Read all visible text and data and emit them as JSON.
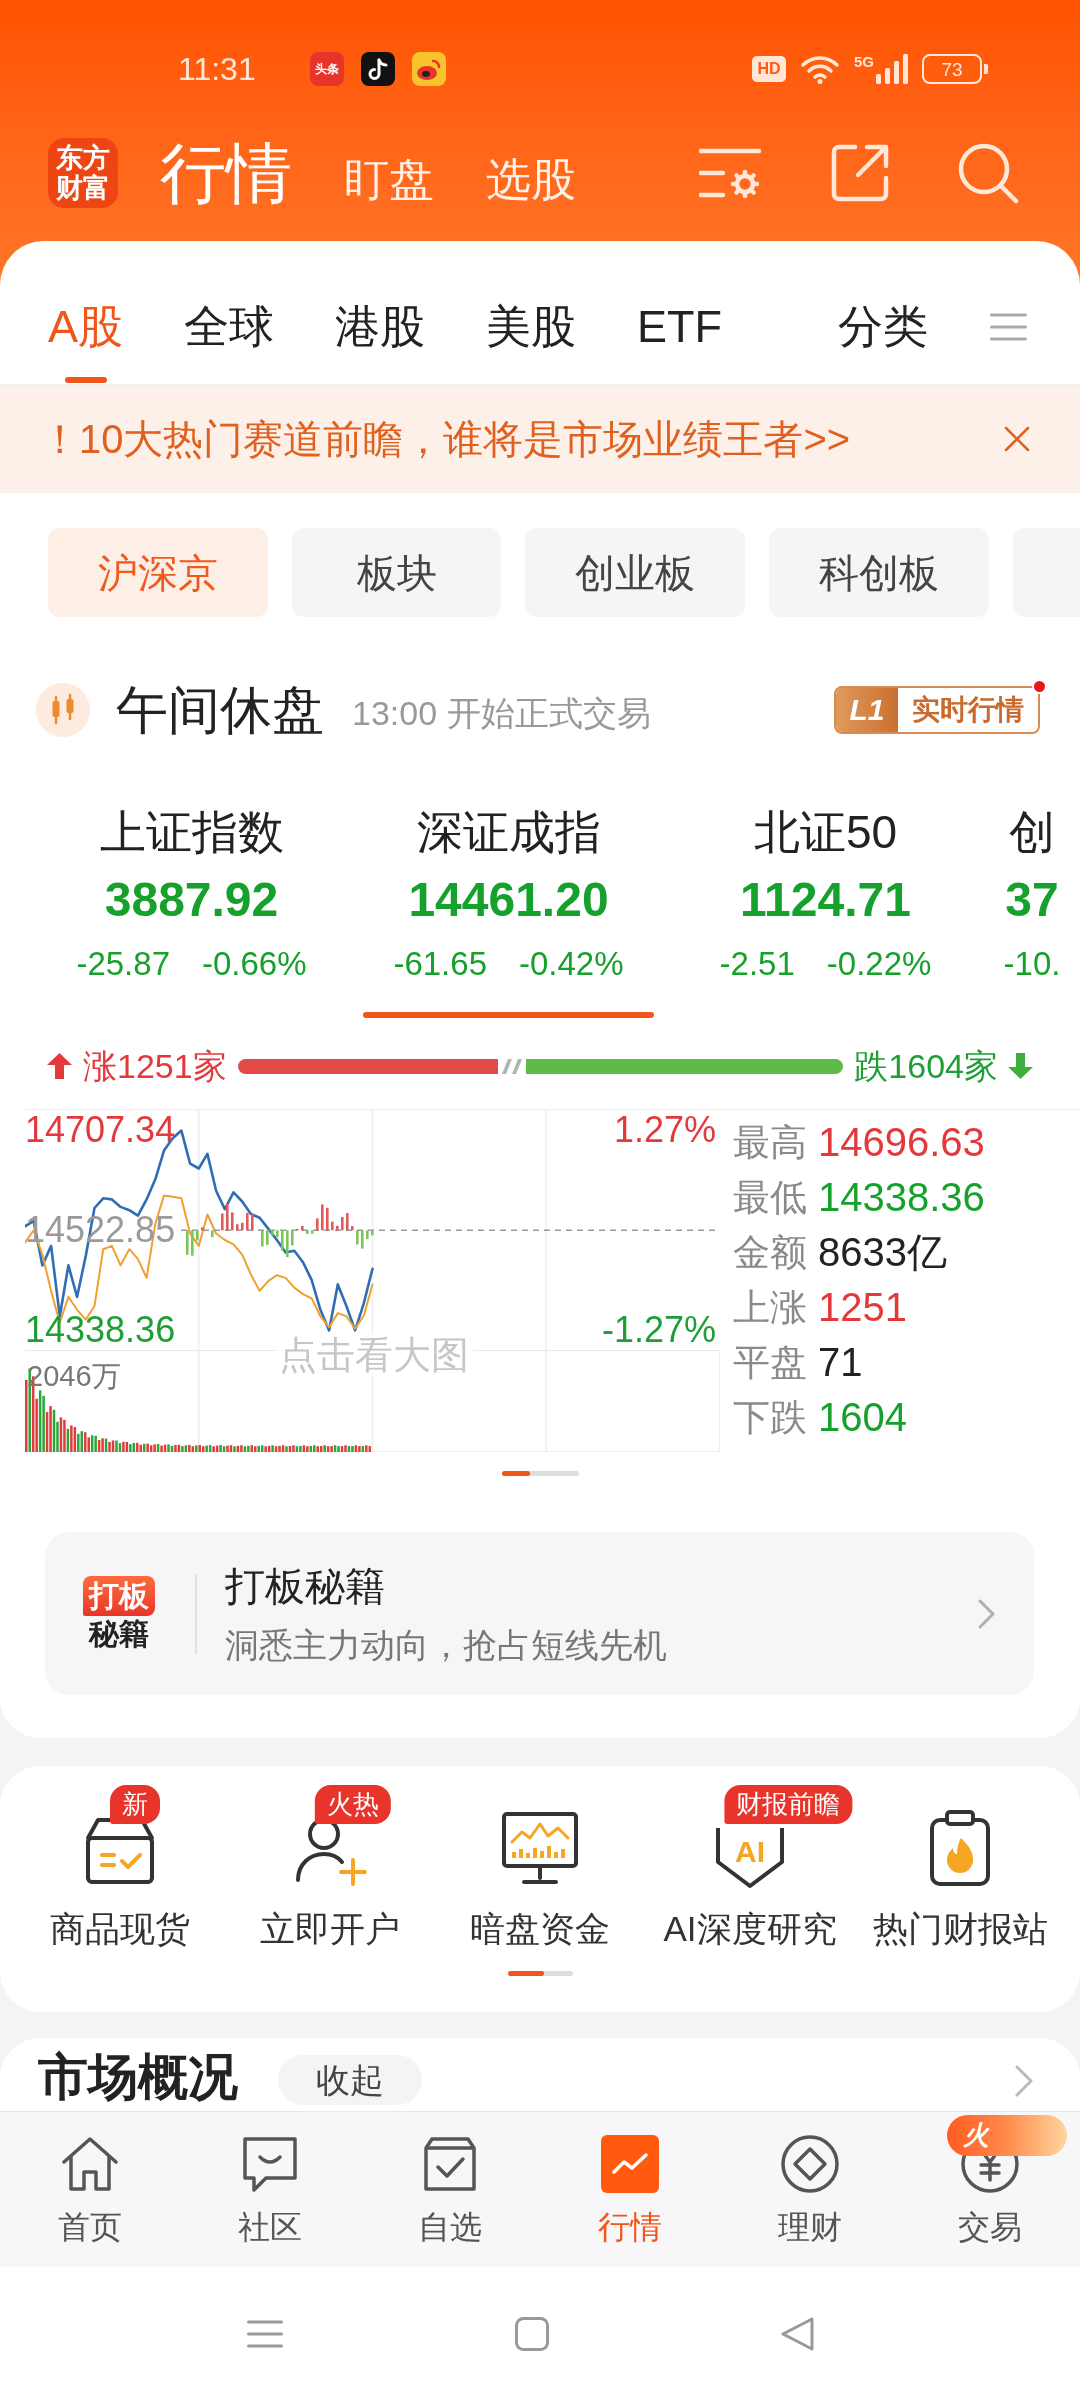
{
  "status_bar": {
    "time": "11:31",
    "notifications": [
      {
        "kind": "text",
        "text": "头条"
      },
      {
        "kind": "note"
      },
      {
        "kind": "eye"
      }
    ],
    "hd": "HD",
    "network": "5G",
    "battery": "73"
  },
  "header": {
    "logo": "东方财富",
    "tabs": [
      {
        "label": "行情",
        "selected": true
      },
      {
        "label": "盯盘",
        "selected": false
      },
      {
        "label": "选股",
        "selected": false
      }
    ]
  },
  "market_tabs": [
    {
      "label": "A股",
      "selected": true
    },
    {
      "label": "全球",
      "selected": false
    },
    {
      "label": "港股",
      "selected": false
    },
    {
      "label": "美股",
      "selected": false
    },
    {
      "label": "ETF",
      "selected": false
    }
  ],
  "category_button": "分类",
  "banner": {
    "mark": "！",
    "text": "10大热门赛道前瞻，谁将是市场业绩王者>>"
  },
  "segments": [
    {
      "label": "沪深京",
      "selected": true
    },
    {
      "label": "板块",
      "selected": false
    },
    {
      "label": "创业板",
      "selected": false
    },
    {
      "label": "科创板",
      "selected": false
    }
  ],
  "segment_overflow": true,
  "session": {
    "status": "午间休盘",
    "note": "13:00 开始正式交易",
    "badge_level": "L1",
    "badge_label": "实时行情",
    "badge_dot": true
  },
  "indices": [
    {
      "name": "上证指数",
      "value": "3887.92",
      "change": "-25.87",
      "percent": "-0.66%",
      "color": "#16a02c",
      "selected": false
    },
    {
      "name": "深证成指",
      "value": "14461.20",
      "change": "-61.65",
      "percent": "-0.42%",
      "color": "#16a02c",
      "selected": true
    },
    {
      "name": "北证50",
      "value": "1124.71",
      "change": "-2.51",
      "percent": "-0.22%",
      "color": "#16a02c",
      "selected": false
    },
    {
      "name": "创",
      "value": "37",
      "change": "-10.",
      "color": "#16a02c",
      "selected": false
    }
  ],
  "breadth": {
    "rise": "涨1251家",
    "fall": "跌1604家",
    "level": 0.43
  },
  "chart": {
    "chart_data": {
      "type": "line",
      "categories": [
        null,
        null,
        null,
        null,
        null,
        null,
        null,
        null,
        null,
        null,
        null,
        null,
        null,
        null,
        null,
        null,
        null,
        null,
        null,
        null,
        null,
        null,
        null,
        null,
        null,
        null,
        null,
        null,
        null,
        null,
        null,
        null,
        null,
        null,
        null,
        null,
        null,
        null,
        null,
        null,
        null,
        null,
        null,
        null,
        null,
        null,
        null,
        null,
        null,
        null,
        null,
        null,
        null,
        null,
        null,
        null,
        null,
        null,
        null,
        null,
        null,
        null,
        null,
        null,
        null,
        null,
        null,
        null,
        null,
        null,
        null,
        null,
        null,
        null,
        null,
        null,
        null,
        null,
        null,
        null,
        null
      ],
      "ylim": [
        14300,
        14745
      ],
      "yticks": [
        {
          "value": 14338.36,
          "label": "14338.36"
        },
        {
          "value": 14522.85,
          "label": "14522.85"
        },
        {
          "value": 14707.34,
          "label": "14707.34"
        }
      ],
      "series": [
        {
          "color": "#2f6db5",
          "values": [
            14530,
            14540,
            14458,
            14494,
            14364,
            14458,
            14400,
            14476,
            14564,
            14582,
            14580,
            14566,
            14560,
            14550,
            14580,
            14617,
            14670,
            14693,
            14707,
            14646,
            14637,
            14664,
            14596,
            14562,
            14593,
            14576,
            14553,
            14546,
            14526,
            14505,
            14482,
            14485,
            14464,
            14431,
            14376,
            14338,
            14423,
            14383,
            14338,
            14388,
            14452,
            null,
            null,
            null,
            null,
            null,
            null,
            null,
            null,
            null,
            null,
            null,
            null,
            null,
            null,
            null,
            null,
            null,
            null,
            null,
            null,
            null,
            null,
            null,
            null,
            null,
            null,
            null,
            null,
            null,
            null,
            null,
            null,
            null,
            null,
            null,
            null,
            null,
            null,
            null,
            null
          ]
        },
        {
          "color": "#f0a030",
          "values": [
            14500,
            14523,
            14478,
            14411,
            14352,
            14400,
            14376,
            14358,
            14383,
            14488,
            14494,
            14458,
            14488,
            14470,
            14435,
            14535,
            14587,
            14585,
            14582,
            14517,
            14494,
            14552,
            14517,
            14505,
            14497,
            14478,
            14441,
            14411,
            14429,
            14440,
            14435,
            14417,
            14405,
            14397,
            14364,
            14344,
            14370,
            14364,
            14341,
            14365,
            14423,
            null,
            null,
            null,
            null,
            null,
            null,
            null,
            null,
            null,
            null,
            null,
            null,
            null,
            null,
            null,
            null,
            null,
            null,
            null,
            null,
            null,
            null,
            null,
            null,
            null,
            null,
            null,
            null,
            null,
            null,
            null,
            null,
            null,
            null,
            null,
            null,
            null,
            null,
            null,
            null
          ]
        }
      ]
    },
    "right_labels": [
      "1.27%",
      "-1.27%"
    ],
    "volume_label": "2046万",
    "hint": "点击看大图"
  },
  "stats": [
    {
      "label": "最高",
      "value": "14696.63",
      "color": "#e4393c"
    },
    {
      "label": "最低",
      "value": "14338.36",
      "color": "#16a02c"
    },
    {
      "label": "金额",
      "value": "8633亿",
      "color": "#222222"
    },
    {
      "label": "上涨",
      "value": "1251",
      "color": "#e4393c"
    },
    {
      "label": "平盘",
      "value": "71",
      "color": "#222222"
    },
    {
      "label": "下跌",
      "value": "1604",
      "color": "#16a02c"
    }
  ],
  "promo": {
    "logo_top": "打板",
    "logo_bottom": "秘籍",
    "title": "打板秘籍",
    "subtitle": "洞悉主力动向，抢占短线先机"
  },
  "shortcuts": [
    {
      "kind": "box",
      "label": "商品现货",
      "badge": "新"
    },
    {
      "kind": "person_add",
      "label": "立即开户",
      "badge": "火热"
    },
    {
      "kind": "monitor",
      "label": "暗盘资金"
    },
    {
      "kind": "shield",
      "icon_text": "AI",
      "label": "AI深度研究",
      "badge": "财报前瞻"
    },
    {
      "kind": "clipboard",
      "label": "热门财报站"
    }
  ],
  "market_overview": {
    "title": "市场概况",
    "toggle": "收起"
  },
  "bottom_nav": [
    {
      "label": "首页",
      "kind": "home",
      "selected": false
    },
    {
      "label": "社区",
      "kind": "chat",
      "selected": false
    },
    {
      "label": "自选",
      "kind": "watchlist",
      "selected": false
    },
    {
      "label": "行情",
      "kind": "chart",
      "selected": true
    },
    {
      "label": "理财",
      "kind": "diamond",
      "selected": false
    },
    {
      "label": "交易",
      "kind": "yen",
      "selected": false
    }
  ],
  "floating_badge": "火"
}
